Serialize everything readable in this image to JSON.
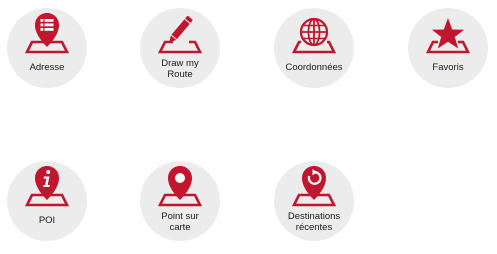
{
  "accent_color": "#c0172e",
  "tile_color": "#ececec",
  "menu": {
    "items": [
      {
        "label": "Adresse",
        "icon": "address-list-pin-icon"
      },
      {
        "label": "Draw my\nRoute",
        "icon": "pencil-draw-icon"
      },
      {
        "label": "Coordonnées",
        "icon": "globe-icon"
      },
      {
        "label": "Favoris",
        "icon": "star-icon"
      },
      {
        "label": "POI",
        "icon": "info-pin-icon"
      },
      {
        "label": "Point sur\ncarte",
        "icon": "map-point-pin-icon"
      },
      {
        "label": "Destinations\nrécentes",
        "icon": "recent-history-pin-icon"
      }
    ]
  }
}
